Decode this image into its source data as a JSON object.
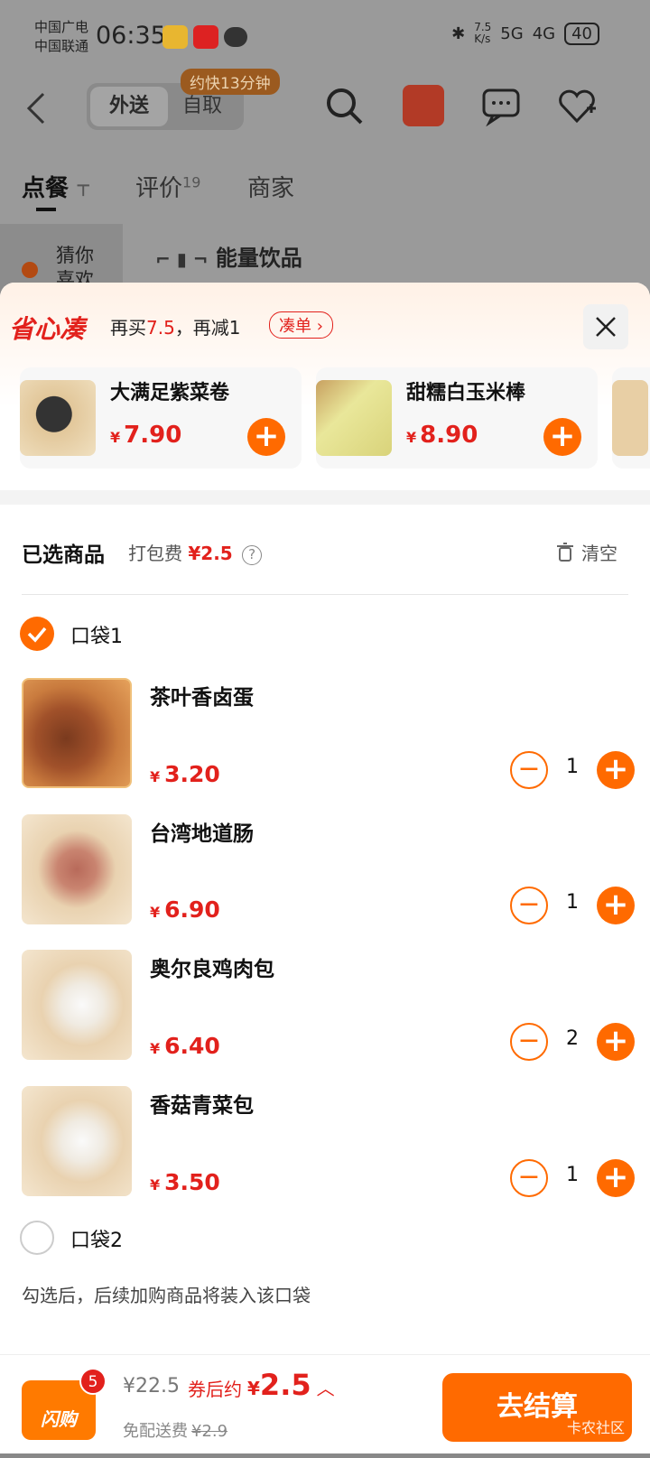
{
  "status_bar": {
    "carrier1": "中国广电",
    "carrier2": "中国联通",
    "time": "06:35",
    "netspeed": "7.5\nK/s",
    "signal1": "5G",
    "signal2": "4G",
    "battery": "40"
  },
  "header": {
    "tab_delivery": "外送",
    "tab_pickup": "自取",
    "pickup_tip": "约快13分钟"
  },
  "shop_tabs": {
    "order": "点餐",
    "review": "评价",
    "review_count": "19",
    "merchant": "商家"
  },
  "category": {
    "guess": "猜你喜欢",
    "section_title": "能量饮品"
  },
  "promo": {
    "brand": "省心凑",
    "text_prefix": "再买",
    "text_amount": "7.5",
    "text_suffix": "，再减1",
    "combine_label": "凑单 ›"
  },
  "recommend": [
    {
      "name": "大满足紫菜卷",
      "currency": "¥",
      "price": "7.90"
    },
    {
      "name": "甜糯白玉米棒",
      "currency": "¥",
      "price": "8.90"
    }
  ],
  "selected": {
    "title": "已选商品",
    "packing_label": "打包费",
    "packing_fee": "¥2.5",
    "help": "?",
    "clear_label": "清空"
  },
  "bags": [
    {
      "label": "口袋1",
      "checked": true
    },
    {
      "label": "口袋2",
      "checked": false
    }
  ],
  "items": [
    {
      "name": "茶叶香卤蛋",
      "currency": "¥",
      "price": "3.20",
      "qty": "1"
    },
    {
      "name": "台湾地道肠",
      "currency": "¥",
      "price": "6.90",
      "qty": "1"
    },
    {
      "name": "奥尔良鸡肉包",
      "currency": "¥",
      "price": "6.40",
      "qty": "2"
    },
    {
      "name": "香菇青菜包",
      "currency": "¥",
      "price": "3.50",
      "qty": "1"
    }
  ],
  "bag_hint": "勾选后，后续加购商品将装入该口袋",
  "footer": {
    "cart_badge": "5",
    "cart_label": "闪购",
    "original_total": "¥22.5",
    "after_label": "券后约",
    "after_currency": "¥",
    "after_price": "2.5",
    "delivery_label": "免配送费",
    "delivery_old": "¥2.9",
    "checkout": "去结算",
    "watermark": "卡农社区"
  },
  "colors": {
    "accent": "#ff6a00",
    "price_red": "#e2211c"
  }
}
